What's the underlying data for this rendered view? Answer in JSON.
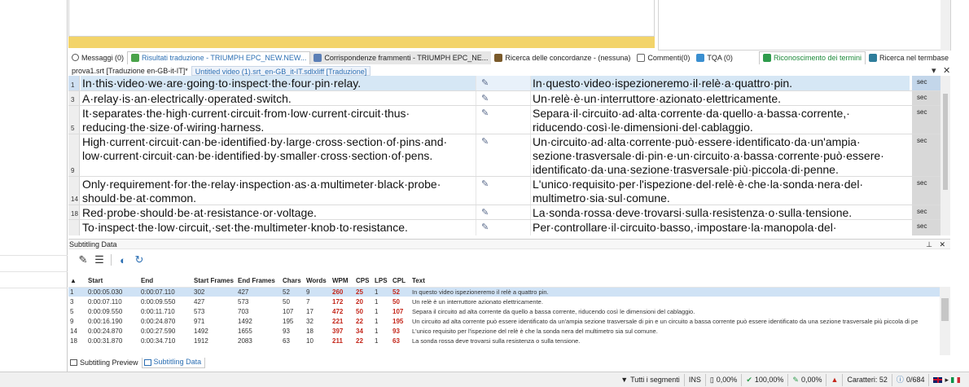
{
  "tabs": [
    {
      "label": "Messaggi (0)",
      "icon": "info-icon"
    },
    {
      "label": "Risultati traduzione - TRIUMPH EPC_NEW.NEW...",
      "icon": "tm-results-icon"
    },
    {
      "label": "Corrispondenze frammenti - TRIUMPH EPC_NE...",
      "icon": "fragment-icon"
    },
    {
      "label": "Ricerca delle concordanze - (nessuna)",
      "icon": "concordance-icon"
    },
    {
      "label": "Commenti(0)",
      "icon": "comment-icon"
    },
    {
      "label": "TQA (0)",
      "icon": "tqa-icon"
    },
    {
      "label": "Riconoscimento dei termini",
      "icon": "term-recognition-icon"
    },
    {
      "label": "Ricerca nel termbase",
      "icon": "termbase-search-icon"
    }
  ],
  "doc_tabs": [
    {
      "label": "prova1.srt [Traduzione en-GB-it-IT]*"
    },
    {
      "label": "Untitled video (1).srt_en-GB_it-IT.sdlxliff [Traduzione]"
    }
  ],
  "segments": [
    {
      "num": "1",
      "source": "In·this·video·we·are·going·to·inspect·the·four·pin·relay.",
      "target": "In·questo·video·ispezioneremo·il·relè·a·quattro·pin.",
      "status": "sec"
    },
    {
      "num": "3",
      "source": "A·relay·is·an·electrically·operated·switch.",
      "target": "Un·relè·è·un·interruttore·azionato·elettricamente.",
      "status": "sec"
    },
    {
      "num": "5",
      "source": "It·separates·the·high·current·circuit·from·low·current·circuit·thus· reducing·the·size·of·wiring·harness.",
      "target": "Separa·il·circuito·ad·alta·corrente·da·quello·a·bassa·corrente,· riducendo·così·le·dimensioni·del·cablaggio.",
      "status": "sec"
    },
    {
      "num": "9",
      "source": "High·current·circuit·can·be·identified·by·large·cross·section·of·pins·and· low·current·circuit·can·be·identified·by·smaller·cross·section·of·pens.",
      "target": "Un·circuito·ad·alta·corrente·può·essere·identificato·da·un'ampia· sezione·trasversale·di·pin·e·un·circuito·a·bassa·corrente·può·essere· identificato·da·una·sezione·trasversale·più·piccola·di·penne.",
      "status": "sec"
    },
    {
      "num": "14",
      "source": "Only·requirement·for·the·relay·inspection·as·a·multimeter·black·probe· should·be·at·common.",
      "target": "L'unico·requisito·per·l'ispezione·del·relè·è·che·la·sonda·nera·del· multimetro·sia·sul·comune.",
      "status": "sec"
    },
    {
      "num": "18",
      "source": "Red·probe·should·be·at·resistance·or·voltage.",
      "target": "La·sonda·rossa·deve·trovarsi·sulla·resistenza·o·sulla·tensione.",
      "status": "sec"
    },
    {
      "num": "20",
      "source": "To·inspect·the·low·circuit,·set·the·multimeter·knob·to·resistance.",
      "target": "Per·controllare·il·circuito·basso,·impostare·la·manopola·del· multimetro·sulla·resistenza.",
      "status": "sec"
    }
  ],
  "subtitling": {
    "title": "Subtitling Data",
    "columns": [
      "Start",
      "End",
      "Start Frames",
      "End Frames",
      "Chars",
      "Words",
      "WPM",
      "CPS",
      "LPS",
      "CPL",
      "Text"
    ],
    "rows": [
      {
        "id": "1",
        "start": "0:00:05.030",
        "end": "0:00:07.110",
        "sf": "302",
        "ef": "427",
        "chars": "52",
        "words": "9",
        "wpm": "260",
        "cps": "25",
        "lps": "1",
        "cpl": "52",
        "text": "In questo video ispezioneremo il relè a quattro pin."
      },
      {
        "id": "3",
        "start": "0:00:07.110",
        "end": "0:00:09.550",
        "sf": "427",
        "ef": "573",
        "chars": "50",
        "words": "7",
        "wpm": "172",
        "cps": "20",
        "lps": "1",
        "cpl": "50",
        "text": "Un relè è un interruttore azionato elettricamente."
      },
      {
        "id": "5",
        "start": "0:00:09.550",
        "end": "0:00:11.710",
        "sf": "573",
        "ef": "703",
        "chars": "107",
        "words": "17",
        "wpm": "472",
        "cps": "50",
        "lps": "1",
        "cpl": "107",
        "text": "Separa il circuito ad alta corrente da quello a bassa corrente, riducendo così le dimensioni del cablaggio."
      },
      {
        "id": "9",
        "start": "0:00:16.190",
        "end": "0:00:24.870",
        "sf": "971",
        "ef": "1492",
        "chars": "195",
        "words": "32",
        "wpm": "221",
        "cps": "22",
        "lps": "1",
        "cpl": "195",
        "text": "Un circuito ad alta corrente può essere identificato da un'ampia sezione trasversale di pin e un circuito a bassa corrente può essere identificato da una sezione trasversale più piccola di pe"
      },
      {
        "id": "14",
        "start": "0:00:24.870",
        "end": "0:00:27.590",
        "sf": "1492",
        "ef": "1655",
        "chars": "93",
        "words": "18",
        "wpm": "397",
        "cps": "34",
        "lps": "1",
        "cpl": "93",
        "text": "L'unico requisito per l'ispezione del relè è che la sonda nera del multimetro sia sul comune."
      },
      {
        "id": "18",
        "start": "0:00:31.870",
        "end": "0:00:34.710",
        "sf": "1912",
        "ef": "2083",
        "chars": "63",
        "words": "10",
        "wpm": "211",
        "cps": "22",
        "lps": "1",
        "cpl": "63",
        "text": "La sonda rossa deve trovarsi sulla resistenza o sulla tensione."
      }
    ],
    "tabs": [
      {
        "label": "Subtitling Preview"
      },
      {
        "label": "Subtitling Data"
      }
    ]
  },
  "statusbar": {
    "filter": "Tutti i segmenti",
    "ins": "INS",
    "pct1": "0,00%",
    "pct2": "100,00%",
    "pct3": "0,00%",
    "chars": "Caratteri: 52",
    "count": "0/684"
  },
  "colors": {
    "selection": "#d6e7f5",
    "warning_red": "#c4271b",
    "link_blue": "#2c6fb3",
    "yellow_bar": "#f3d46a"
  }
}
